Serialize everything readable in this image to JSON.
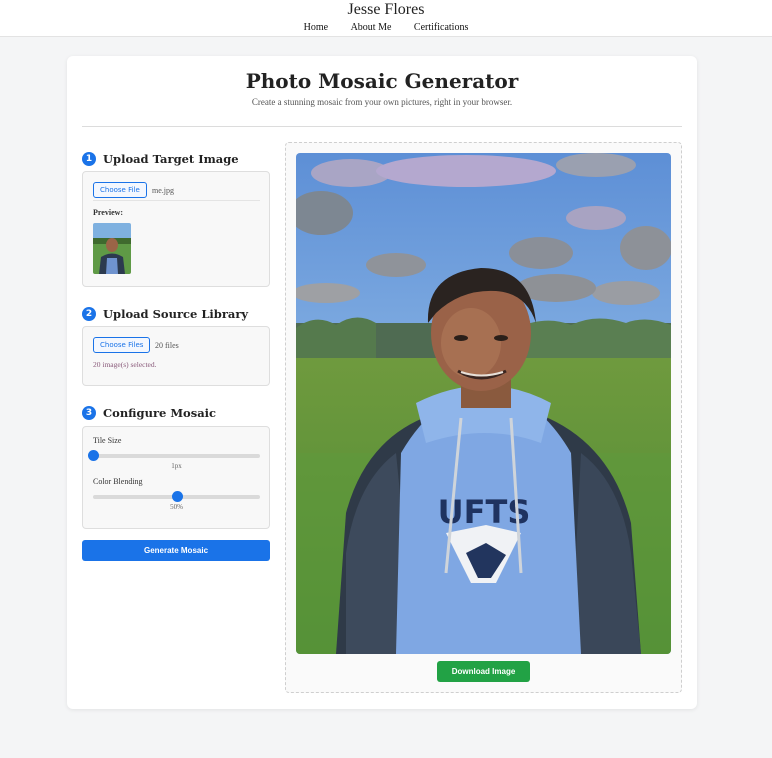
{
  "site": {
    "name": "Jesse Flores",
    "nav": [
      "Home",
      "About Me",
      "Certifications"
    ]
  },
  "header": {
    "title": "Photo Mosaic Generator",
    "subtitle": "Create a stunning mosaic from your own pictures, right in your browser."
  },
  "steps": {
    "target": {
      "number": "1",
      "title": "Upload Target Image",
      "button": "Choose File",
      "file_name": "me.jpg",
      "preview_label": "Preview:"
    },
    "library": {
      "number": "2",
      "title": "Upload Source Library",
      "button": "Choose Files",
      "file_count": "20 files",
      "selected_text": "20 image(s) selected."
    },
    "config": {
      "number": "3",
      "title": "Configure Mosaic",
      "tile_size_label": "Tile Size",
      "tile_size_value": "1px",
      "tile_size_level": 0.0,
      "blend_label": "Color Blending",
      "blend_value": "50%",
      "blend_level": 0.5
    }
  },
  "actions": {
    "generate": "Generate Mosaic",
    "download": "Download Image"
  },
  "colors": {
    "accent": "#1a73e8",
    "download": "#22a245"
  }
}
